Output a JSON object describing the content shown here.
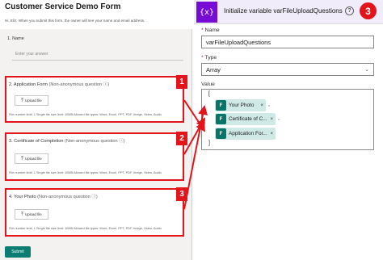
{
  "form": {
    "title": "Customer Service Demo Form",
    "description": "Hi, Eliz. When you submit this form, the owner will see your name and email address.",
    "name_question": {
      "label": "1. Name",
      "placeholder": "Enter your answer"
    },
    "questions": [
      {
        "number": "2.",
        "title": "Application Form",
        "sub": "(Non-anonymous question ⓘ)",
        "upload_label": "Upload file",
        "limits": "File number limit: 1   Single file size limit: 10MB   Allowed file types: Word, Excel, PPT, PDF, Image, Video, Audio"
      },
      {
        "number": "3.",
        "title": "Certificate of Completion",
        "sub": "(Non-anonymous question ⓘ)",
        "upload_label": "Upload file",
        "limits": "File number limit: 1   Single file size limit: 10MB   Allowed file types: Word, Excel, PPT, PDF, Image, Video, Audio"
      },
      {
        "number": "4.",
        "title": "Your Photo",
        "sub": "(Non-anonymous question ⓘ)",
        "upload_label": "Upload file",
        "limits": "File number limit: 1   Single file size limit: 10MB   Allowed file types: Word, Excel, PPT, PDF, Image, Video, Audio"
      }
    ],
    "submit_label": "Submit",
    "badges": [
      "1",
      "2",
      "3"
    ]
  },
  "action": {
    "icon_text": "{x}",
    "title": "Initialize variable varFileUploadQuestions",
    "help_icon": "?",
    "badge": "3",
    "name_label": "Name",
    "name_value": "varFileUploadQuestions",
    "type_label": "Type",
    "type_value": "Array",
    "value_label": "Value",
    "open_bracket": "[",
    "close_bracket": "]",
    "tokens": [
      {
        "text": "Your Photo",
        "suffix": ","
      },
      {
        "text": "Certificate of C...",
        "suffix": ","
      },
      {
        "text": "Application For...",
        "suffix": ""
      }
    ]
  },
  "colors": {
    "highlight_red": "#e3151a",
    "forms_teal": "#077568",
    "token_bg": "#cfe9e7",
    "variable_purple": "#770bd6",
    "submit_teal": "#0d7d74"
  }
}
